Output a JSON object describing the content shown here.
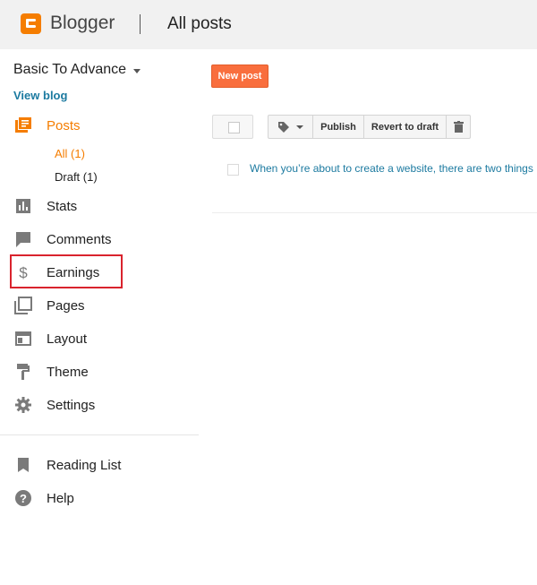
{
  "header": {
    "brand": "Blogger",
    "page_title": "All posts"
  },
  "sidebar": {
    "blog_name": "Basic To Advance",
    "view_blog": "View blog",
    "posts_label": "Posts",
    "posts_sub": [
      {
        "label": "All (1)"
      },
      {
        "label": "Draft (1)"
      }
    ],
    "items": [
      {
        "label": "Stats"
      },
      {
        "label": "Comments"
      },
      {
        "label": "Earnings"
      },
      {
        "label": "Pages"
      },
      {
        "label": "Layout"
      },
      {
        "label": "Theme"
      },
      {
        "label": "Settings"
      }
    ],
    "bottom_items": [
      {
        "label": "Reading List"
      },
      {
        "label": "Help"
      }
    ]
  },
  "main": {
    "new_post": "New post",
    "toolbar": {
      "publish": "Publish",
      "revert": "Revert to draft"
    },
    "posts": [
      {
        "title": "When you’re about to create a website, there are two things"
      }
    ]
  },
  "colors": {
    "accent": "#f57d00",
    "link": "#1c7aa0",
    "new_post_bg": "#f96e3d",
    "highlight": "#d9232d",
    "icon_gray": "#7a7a7a"
  },
  "icons": [
    "blogger-logo-icon",
    "posts-icon",
    "stats-icon",
    "comments-icon",
    "dollar-icon",
    "pages-icon",
    "layout-icon",
    "theme-icon",
    "settings-icon",
    "bookmark-icon",
    "help-icon",
    "label-icon",
    "trash-icon"
  ]
}
